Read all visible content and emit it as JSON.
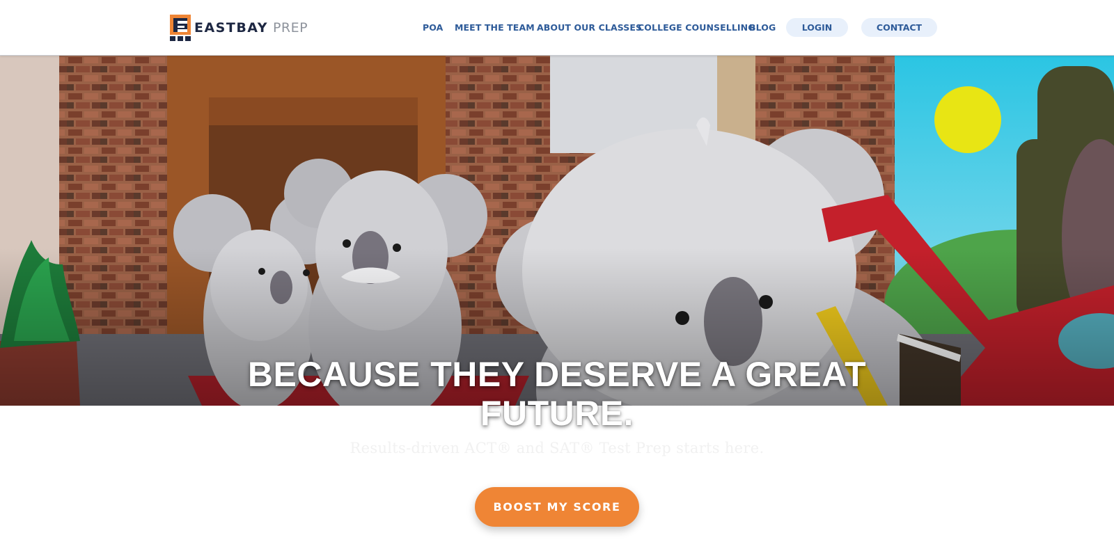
{
  "brand": {
    "logo_icon": "eastbay-e-logo-icon",
    "name_bold": "EASTBAY",
    "name_light": "PREP",
    "colors": {
      "navy": "#1d2742",
      "orange": "#ef8535"
    }
  },
  "nav": {
    "items": [
      {
        "label": "POA"
      },
      {
        "label": "MEET THE TEAM"
      },
      {
        "label": "ABOUT OUR CLASSES"
      },
      {
        "label": "COLLEGE COUNSELLING"
      },
      {
        "label": "BLOG"
      }
    ],
    "login_label": "LOGIN",
    "contact_label": "CONTACT",
    "link_color": "#2e5b99",
    "pill_color": "#e8f0fb"
  },
  "hero": {
    "illustration": "koala-family-illustration",
    "headline_line1": "BECAUSE THEY DESERVE A GREAT",
    "headline_line2": "FUTURE.",
    "subheadline": "Results-driven ACT® and SAT® Test Prep starts here.",
    "cta_label": "BOOST MY SCORE",
    "cta_color": "#ef8535"
  }
}
